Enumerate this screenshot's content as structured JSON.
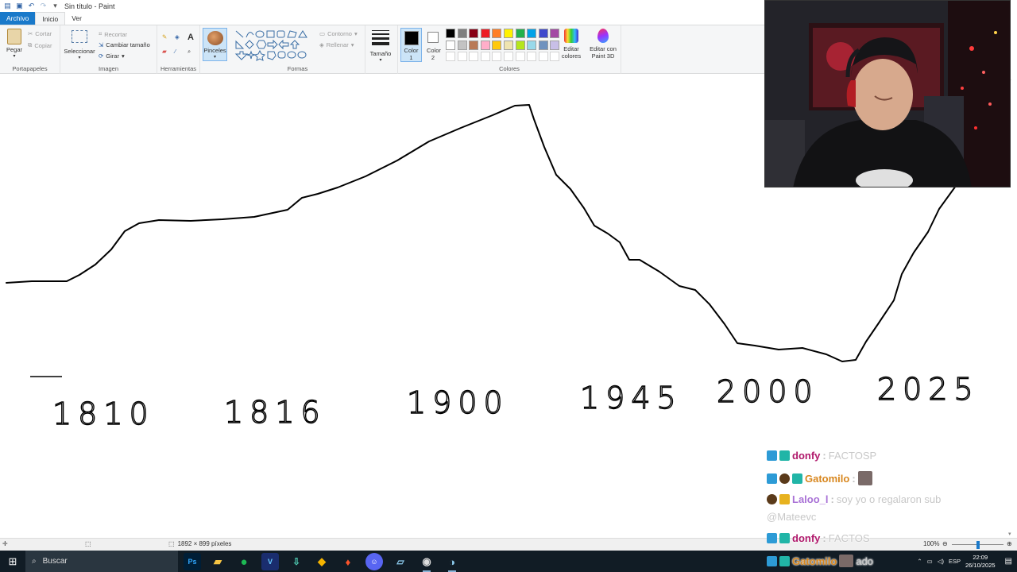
{
  "window": {
    "title": "Sin título - Paint"
  },
  "menu": {
    "tabs": [
      "Archivo",
      "Inicio",
      "Ver"
    ]
  },
  "ribbon": {
    "portapapeles": {
      "label": "Portapapeles",
      "paste": "Pegar",
      "cut": "Cortar",
      "copy": "Copiar"
    },
    "imagen": {
      "label": "Imagen",
      "select": "Seleccionar",
      "crop": "Recortar",
      "resize": "Cambiar tamaño",
      "rotate": "Girar"
    },
    "herramientas": {
      "label": "Herramientas"
    },
    "pinceles": {
      "label": "Pinceles"
    },
    "formas": {
      "label": "Formas",
      "outline": "Contorno",
      "fill": "Rellenar"
    },
    "tamano": {
      "label": "Tamaño"
    },
    "colores": {
      "label": "Colores",
      "color1": "Color 1",
      "color2": "Color 2",
      "edit_colors": "Editar colores",
      "paint3d": "Editar con Paint 3D"
    },
    "palette_row1": [
      "#000000",
      "#7f7f7f",
      "#880015",
      "#ed1c24",
      "#ff7f27",
      "#fff200",
      "#22b14c",
      "#00a2e8",
      "#3f48cc",
      "#a349a4"
    ],
    "palette_row2": [
      "#ffffff",
      "#c3c3c3",
      "#b97a57",
      "#ffaec9",
      "#ffc90e",
      "#efe4b0",
      "#b5e61d",
      "#99d9ea",
      "#7092be",
      "#c8bfe7"
    ]
  },
  "drawing": {
    "years": [
      "1810",
      "1816",
      "1900",
      "1945",
      "2000",
      "2025"
    ]
  },
  "statusbar": {
    "dimensions": "1892 × 899 píxeles",
    "zoom": "100%",
    "zoom_level": 1.0
  },
  "taskbar": {
    "search": "Buscar",
    "language": "ESP",
    "time": "22:09",
    "date": "26/10/2025",
    "apps": [
      "Ps",
      "Explorador",
      "Spotify",
      "V",
      "Descargas",
      "Chrome",
      "Brave",
      "Discord",
      "Notas",
      "OBS",
      "Paint"
    ]
  },
  "chat": [
    {
      "user": "donfy",
      "user_color": "#b0186b",
      "message": "FACTOSP"
    },
    {
      "user": "Gatomilo",
      "user_color": "#d8871f",
      "message": ""
    },
    {
      "user": "Laloo_l",
      "user_color": "#a972d6",
      "message": "soy yo o regalaron sub"
    },
    {
      "user": "",
      "user_color": "#c8c8c8",
      "message": "@Mateevc"
    },
    {
      "user": "donfy",
      "user_color": "#b0186b",
      "message": "FACTOS"
    },
    {
      "user": "Gatomilo",
      "user_color": "#d8871f",
      "message": "ado"
    }
  ],
  "colors": {
    "accent": "#1979ca",
    "taskbar": "#111c25"
  }
}
